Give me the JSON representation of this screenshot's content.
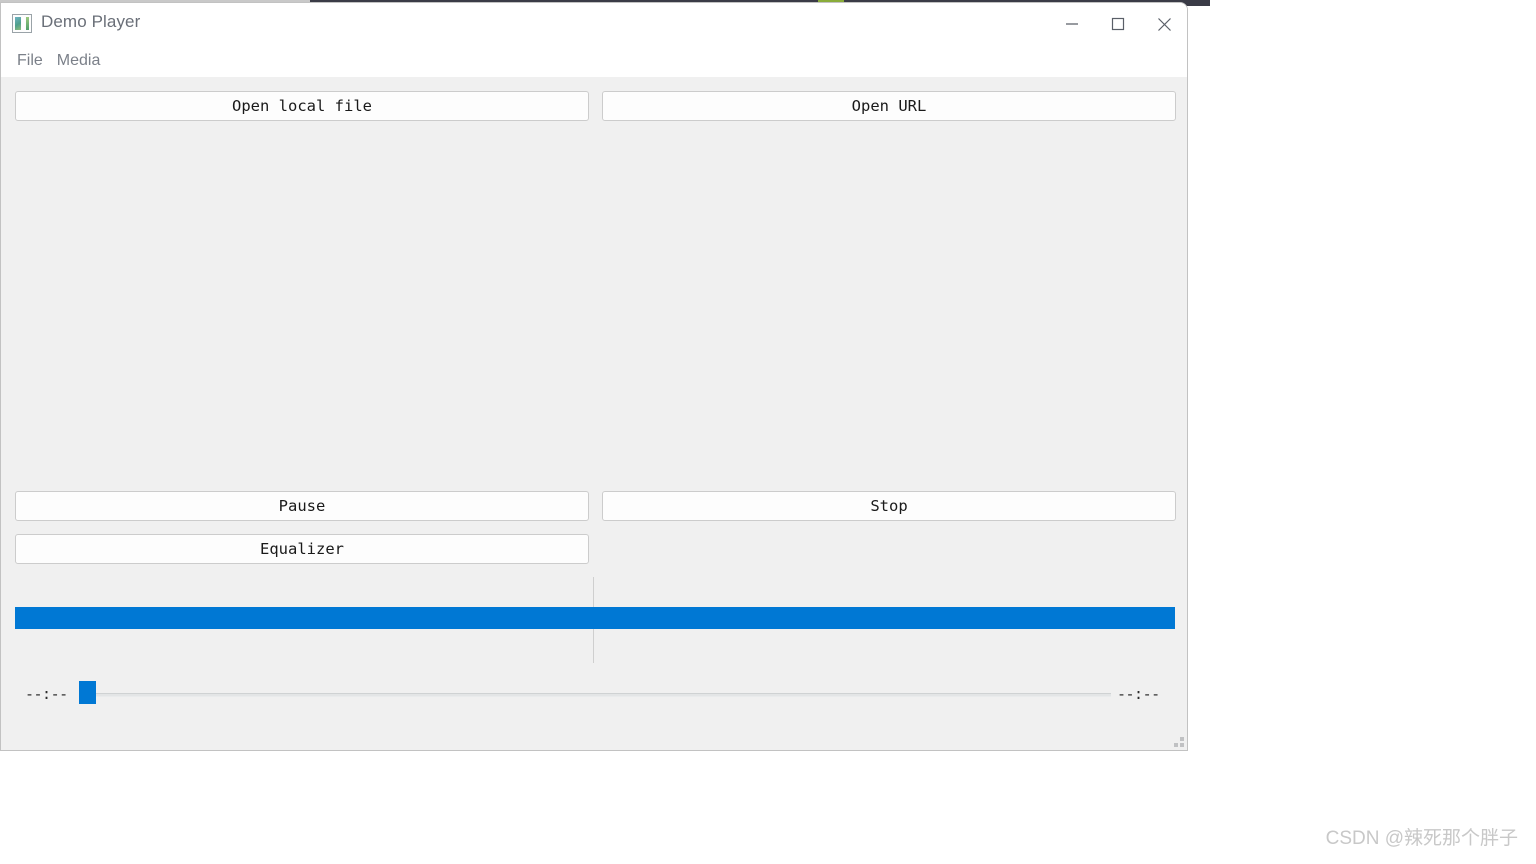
{
  "window": {
    "title": "Demo Player",
    "icon": "media-player-icon",
    "controls": {
      "minimize": "minimize-icon",
      "maximize": "maximize-icon",
      "close": "close-icon"
    }
  },
  "menubar": {
    "items": [
      {
        "label": "File"
      },
      {
        "label": "Media"
      }
    ]
  },
  "toolbar": {
    "open_local_file": "Open local file",
    "open_url": "Open URL"
  },
  "transport": {
    "pause": "Pause",
    "stop": "Stop",
    "equalizer": "Equalizer"
  },
  "progress": {
    "value_percent": 100,
    "color": "#0078d4"
  },
  "seek": {
    "elapsed": "--:--",
    "total": "--:--",
    "value_percent": 0,
    "handle_color": "#0078d4"
  },
  "colors": {
    "accent": "#0078d4",
    "window_background": "#ffffff",
    "content_background": "#f0f0f0",
    "button_background": "#fdfdfd",
    "button_border": "#cccccc",
    "title_text": "#6a6f78",
    "menu_text": "#7b8089"
  },
  "watermark": {
    "text": "CSDN @辣死那个胖子"
  }
}
